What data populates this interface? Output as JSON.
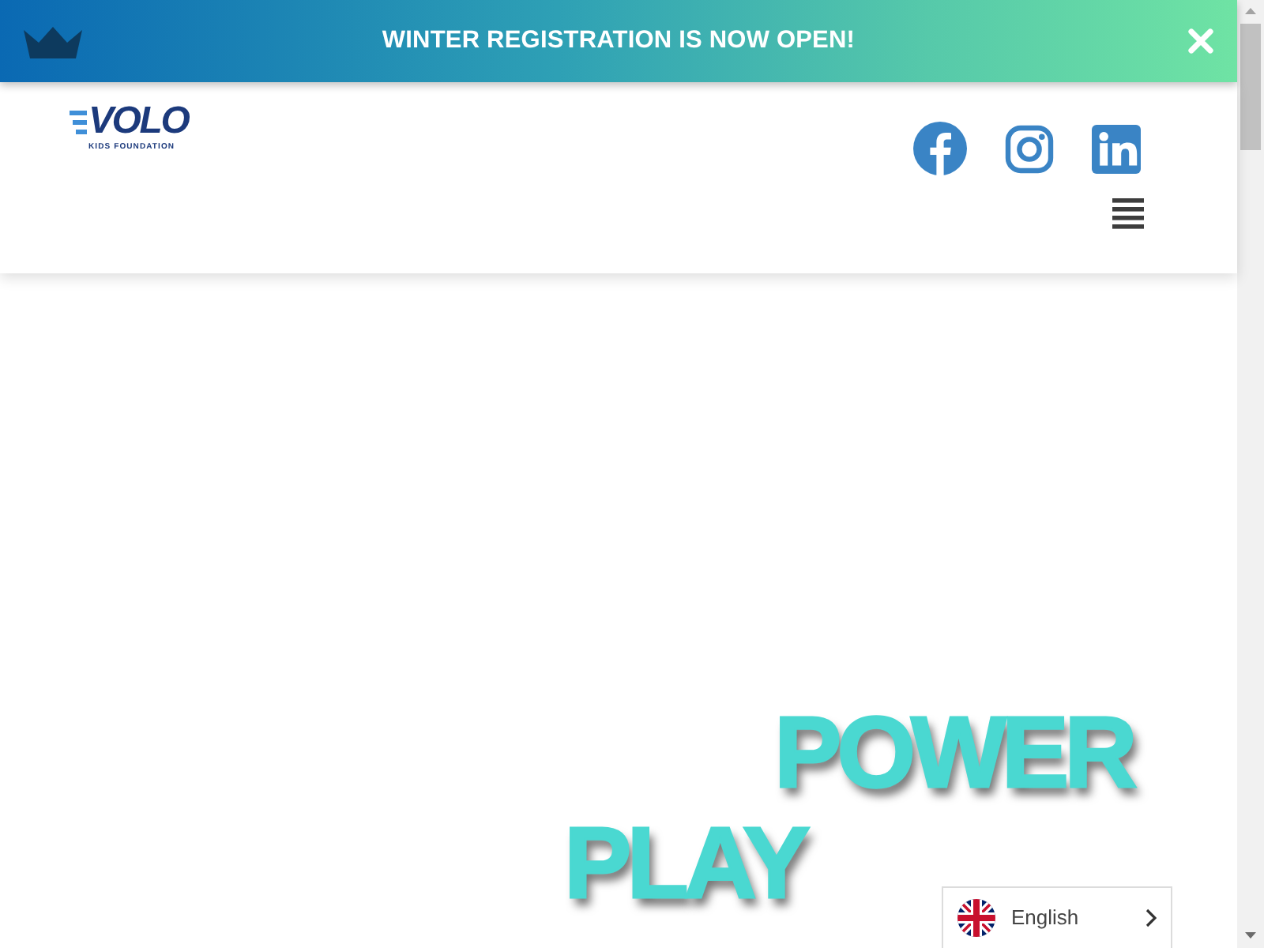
{
  "announcement": {
    "text": "WINTER REGISTRATION IS NOW OPEN!"
  },
  "header": {
    "logo": {
      "wordmark": "VOLO",
      "tagline": "KIDS FOUNDATION"
    }
  },
  "hero": {
    "title_lines": [
      "POWER",
      "PLAY"
    ]
  },
  "language_selector": {
    "label": "English"
  }
}
